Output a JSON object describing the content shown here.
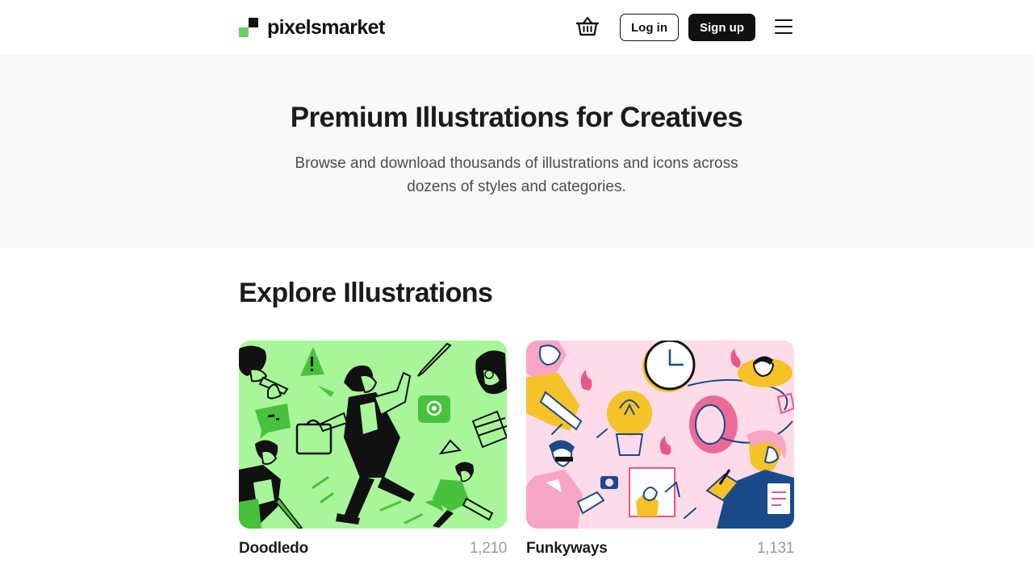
{
  "header": {
    "logo_text": "pixelsmarket",
    "login_label": "Log in",
    "signup_label": "Sign up",
    "colors": {
      "logo_green": "#6ccf6a",
      "dark": "#111111"
    },
    "icons": [
      "basket-icon",
      "hamburger-menu-icon"
    ]
  },
  "hero": {
    "title": "Premium Illustrations for Creatives",
    "subtitle": "Browse and download thousands of illustrations and icons across dozens of styles and categories.",
    "background": "#f8f8f8"
  },
  "explore": {
    "title": "Explore Illustrations",
    "cards": [
      {
        "name": "Doodledo",
        "count": "1,210",
        "background": "#a8f59a"
      },
      {
        "name": "Funkyways",
        "count": "1,131",
        "background": "#fddbe8"
      }
    ]
  }
}
